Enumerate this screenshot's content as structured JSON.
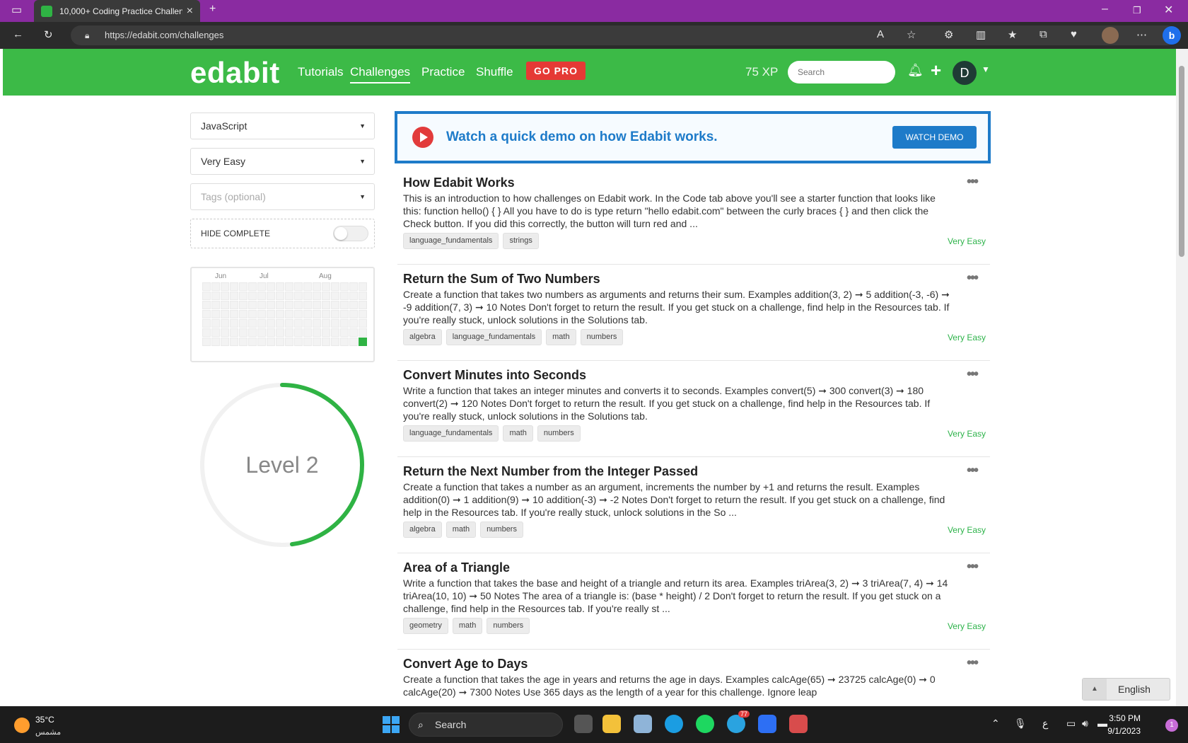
{
  "browser": {
    "tab_title": "10,000+ Coding Practice Challen",
    "url": "https://edabit.com/challenges"
  },
  "site": {
    "logo": "edabit",
    "nav": [
      "Tutorials",
      "Challenges",
      "Practice",
      "Shuffle"
    ],
    "go_pro": "GO PRO",
    "xp": "75 XP",
    "search_placeholder": "Search",
    "avatar_letter": "D"
  },
  "sidebar": {
    "language": "JavaScript",
    "difficulty": "Very Easy",
    "tags_placeholder": "Tags (optional)",
    "hide_complete": "HIDE COMPLETE",
    "months": [
      "Jun",
      "Jul",
      "Aug"
    ],
    "level": "Level 2",
    "level_progress": 0.48
  },
  "banner": {
    "text": "Watch a quick demo on how Edabit works.",
    "button": "WATCH DEMO"
  },
  "challenges": [
    {
      "title": "How Edabit Works",
      "desc": "This is an introduction to how challenges on Edabit work. In the Code tab above you'll see a starter function that looks like this: function hello() { } All you have to do is type return \"hello edabit.com\" between the curly braces { } and then click the Check button. If you did this correctly, the button will turn red and ...",
      "tags": [
        "language_fundamentals",
        "strings"
      ],
      "level": "Very Easy"
    },
    {
      "title": "Return the Sum of Two Numbers",
      "desc": "Create a function that takes two numbers as arguments and returns their sum. Examples addition(3, 2) ➞ 5 addition(-3, -6) ➞ -9 addition(7, 3) ➞ 10 Notes Don't forget to return the result. If you get stuck on a challenge, find help in the Resources tab. If you're really stuck, unlock solutions in the Solutions tab.",
      "tags": [
        "algebra",
        "language_fundamentals",
        "math",
        "numbers"
      ],
      "level": "Very Easy"
    },
    {
      "title": "Convert Minutes into Seconds",
      "desc": "Write a function that takes an integer minutes and converts it to seconds. Examples convert(5) ➞ 300 convert(3) ➞ 180 convert(2) ➞ 120 Notes Don't forget to return the result. If you get stuck on a challenge, find help in the Resources tab. If you're really stuck, unlock solutions in the Solutions tab.",
      "tags": [
        "language_fundamentals",
        "math",
        "numbers"
      ],
      "level": "Very Easy"
    },
    {
      "title": "Return the Next Number from the Integer Passed",
      "desc": "Create a function that takes a number as an argument, increments the number by +1 and returns the result. Examples addition(0) ➞ 1 addition(9) ➞ 10 addition(-3) ➞ -2 Notes Don't forget to return the result. If you get stuck on a challenge, find help in the Resources tab. If you're really stuck, unlock solutions in the So ...",
      "tags": [
        "algebra",
        "math",
        "numbers"
      ],
      "level": "Very Easy"
    },
    {
      "title": "Area of a Triangle",
      "desc": "Write a function that takes the base and height of a triangle and return its area. Examples triArea(3, 2) ➞ 3 triArea(7, 4) ➞ 14 triArea(10, 10) ➞ 50 Notes The area of a triangle is: (base * height) / 2 Don't forget to return the result. If you get stuck on a challenge, find help in the Resources tab. If you're really st ...",
      "tags": [
        "geometry",
        "math",
        "numbers"
      ],
      "level": "Very Easy"
    },
    {
      "title": "Convert Age to Days",
      "desc": "Create a function that takes the age in years and returns the age in days. Examples calcAge(65) ➞ 23725 calcAge(0) ➞ 0 calcAge(20) ➞ 7300 Notes Use 365 days as the length of a year for this challenge. Ignore leap",
      "tags": [],
      "level": ""
    }
  ],
  "language_button": "English",
  "taskbar": {
    "temp": "35°C",
    "weather": "مشمس",
    "search": "Search",
    "time": "3:50 PM",
    "date": "9/1/2023",
    "notif_count": "1",
    "badge": "77"
  },
  "colors": {
    "brand_green": "#3cba47",
    "accent_blue": "#1e7bc9",
    "pro_red": "#e53935"
  }
}
